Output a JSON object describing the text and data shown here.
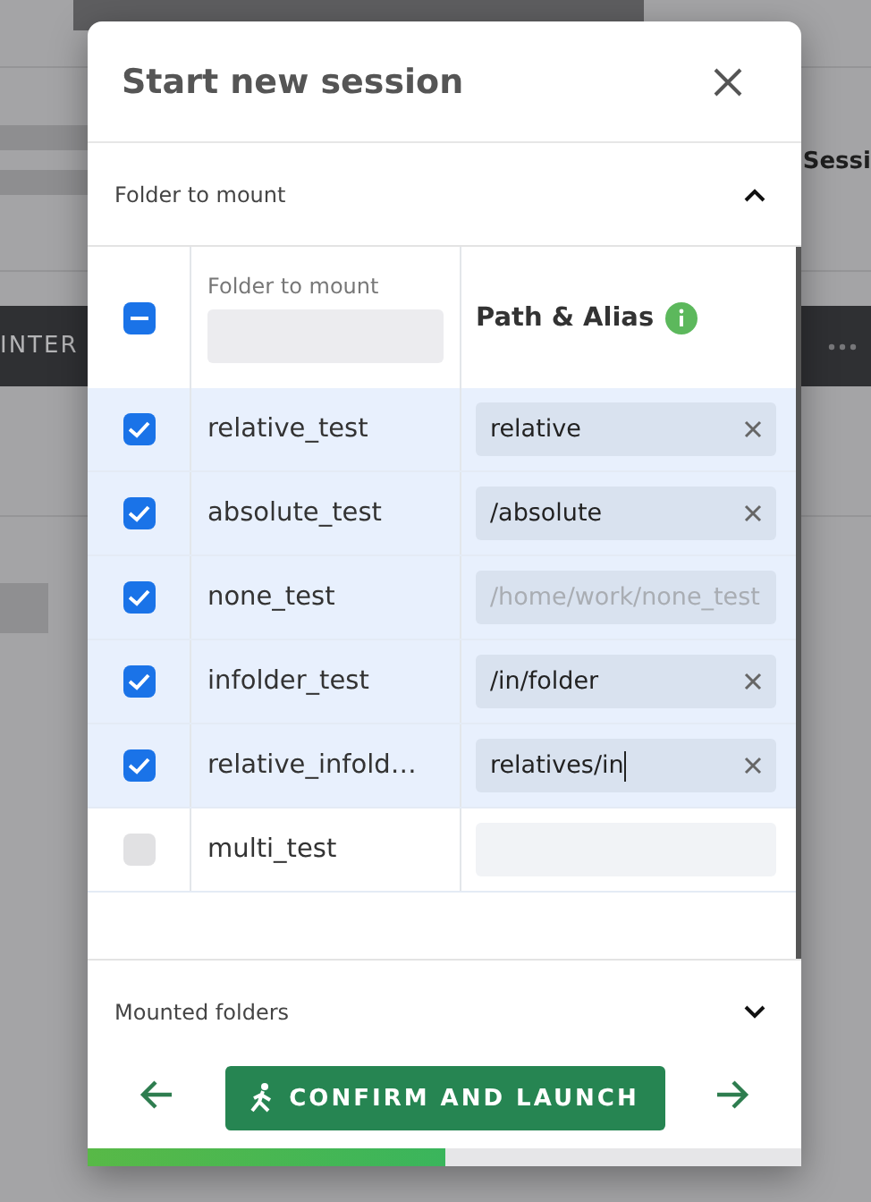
{
  "background": {
    "tab_fragment": "INTER",
    "heading_fragment": "Sessi"
  },
  "dialog": {
    "title": "Start new session",
    "folder_section": {
      "title": "Folder to mount",
      "expanded": true,
      "table": {
        "columns": [
          {
            "label": "Folder to mount",
            "kind": "filter"
          },
          {
            "label": "Path & Alias",
            "kind": "info"
          }
        ],
        "select_all": {
          "indeterminate": true
        },
        "rows": [
          {
            "name": "relative_test",
            "checked": true,
            "alias": "relative",
            "clearable": true,
            "focused": false
          },
          {
            "name": "absolute_test",
            "checked": true,
            "alias": "/absolute",
            "clearable": true,
            "focused": false
          },
          {
            "name": "none_test",
            "checked": true,
            "placeholder": "/home/work/none_test",
            "clearable": false,
            "focused": false
          },
          {
            "name": "infolder_test",
            "checked": true,
            "alias": "/in/folder",
            "clearable": true,
            "focused": false
          },
          {
            "name": "relative_infold…",
            "checked": true,
            "alias": "relatives/in",
            "clearable": true,
            "focused": true
          },
          {
            "name": "multi_test",
            "checked": false,
            "clearable": false,
            "focused": false
          }
        ]
      }
    },
    "mounted_section": {
      "title": "Mounted folders",
      "expanded": false
    },
    "launch_button": "CONFIRM AND LAUNCH",
    "progress": {
      "level": 0.5
    }
  }
}
